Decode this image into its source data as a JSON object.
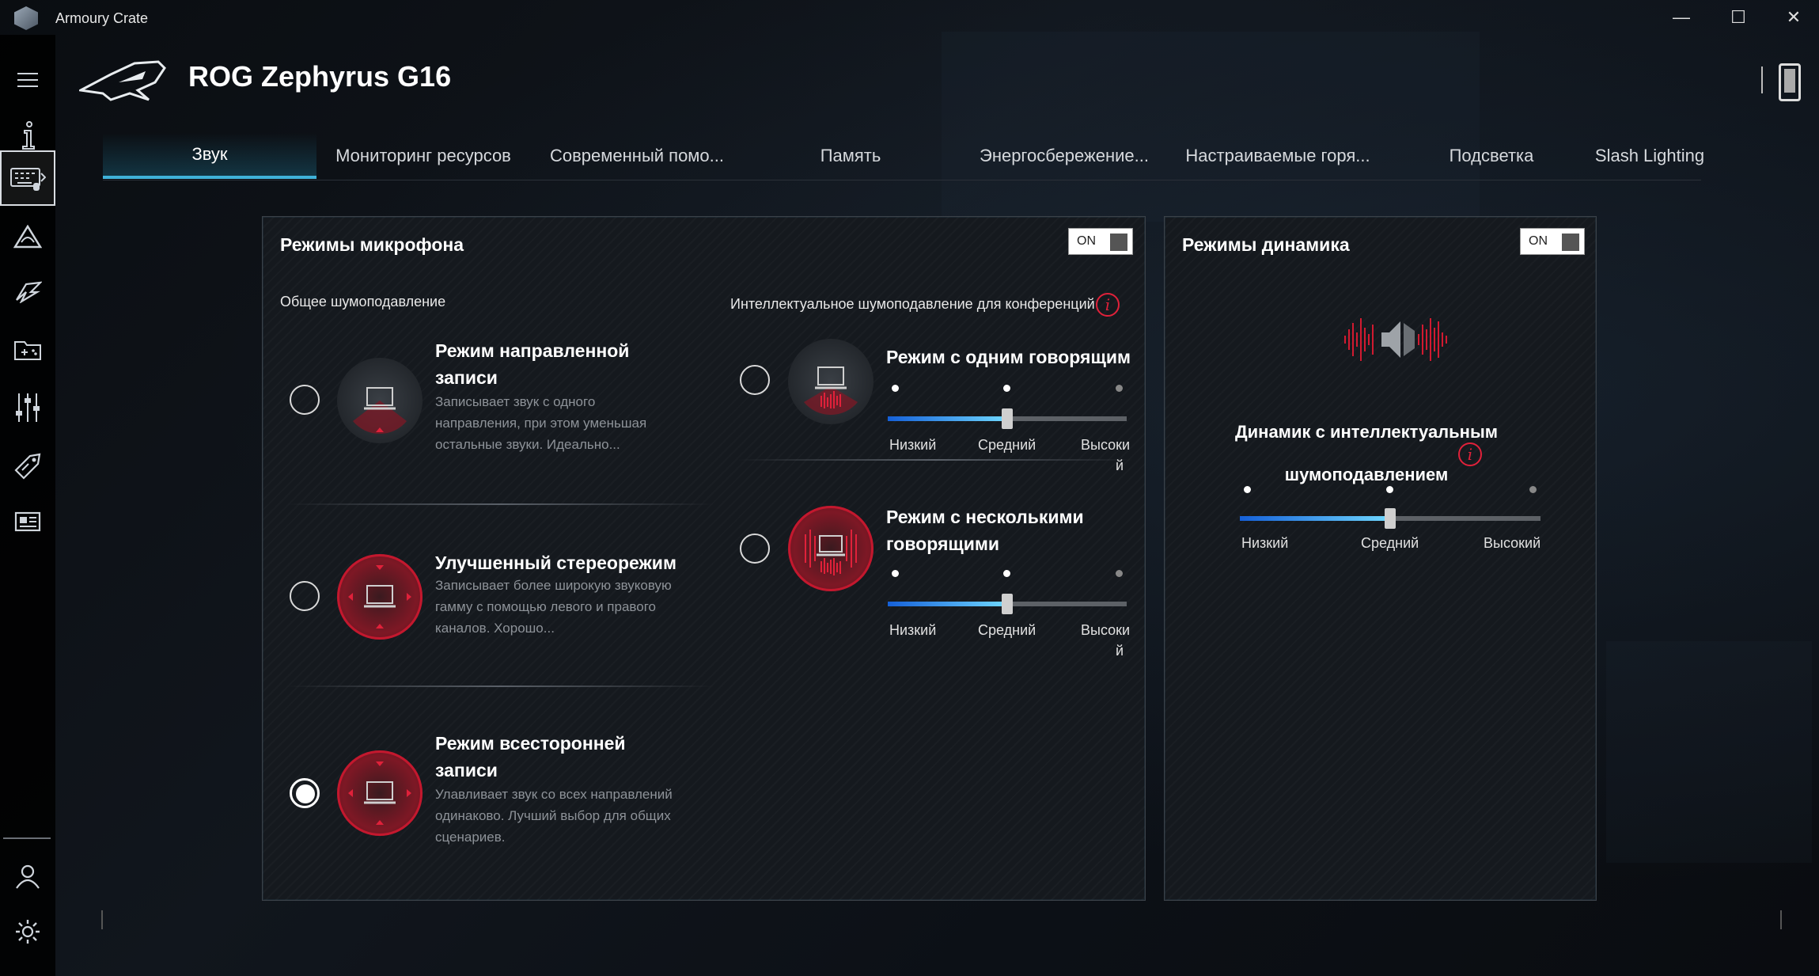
{
  "window": {
    "app_title": "Armoury Crate",
    "minimize_glyph": "—",
    "maximize_glyph": "☐",
    "close_glyph": "✕"
  },
  "header": {
    "device_name": "ROG Zephyrus G16"
  },
  "sidebar": {
    "items": [
      {
        "icon": "hamburger-menu-icon"
      },
      {
        "icon": "info-icon"
      },
      {
        "icon": "keyboard-device-icon",
        "active": true
      },
      {
        "icon": "aura-sync-icon"
      },
      {
        "icon": "armoury-scenario-icon"
      },
      {
        "icon": "game-library-icon"
      },
      {
        "icon": "settings-sliders-icon"
      },
      {
        "icon": "deals-tag-icon"
      },
      {
        "icon": "news-icon"
      },
      {
        "icon": "user-center-icon"
      },
      {
        "icon": "settings-gear-icon"
      }
    ]
  },
  "tabs": [
    {
      "label": "Звук",
      "active": true
    },
    {
      "label": "Мониторинг ресурсов"
    },
    {
      "label": "Современный помо..."
    },
    {
      "label": "Память"
    },
    {
      "label": "Энергосбережение..."
    },
    {
      "label": "Настраиваемые горя..."
    },
    {
      "label": "Подсветка"
    },
    {
      "label": "Slash Lighting"
    }
  ],
  "mic_panel": {
    "title": "Режимы микрофона",
    "toggle": "ON",
    "general_heading": "Общее шумоподавление",
    "ai_heading": "Интеллектуальное шумоподавление для конференций",
    "info_glyph": "i",
    "general_modes": [
      {
        "title": "Режим направленной записи",
        "desc": "Записывает звук с одного направления, при этом уменьшая остальные звуки. Идеально...",
        "selected": false
      },
      {
        "title": "Улучшенный стереорежим",
        "desc": "Записывает более широкую звуковую гамму с помощью левого и правого каналов. Хорошо...",
        "selected": false
      },
      {
        "title": "Режим всесторонней записи",
        "desc": "Улавливает звук со всех направлений одинаково. Лучший выбор для общих сценариев.",
        "selected": true
      }
    ],
    "ai_modes": [
      {
        "title": "Режим с одним говорящим",
        "selected": false,
        "level": 0.5,
        "labels": {
          "low": "Низкий",
          "mid": "Средний",
          "high": "Высоки",
          "high_wrap": "й"
        }
      },
      {
        "title": "Режим с несколькими говорящими",
        "selected": false,
        "level": 0.5,
        "labels": {
          "low": "Низкий",
          "mid": "Средний",
          "high": "Высоки",
          "high_wrap": "й"
        }
      }
    ]
  },
  "speaker_panel": {
    "title": "Режимы динамика",
    "toggle": "ON",
    "mode_title_line1": "Динамик с интеллектуальным",
    "mode_title_line2": "шумоподавлением",
    "info_glyph": "i",
    "level": 0.5,
    "labels": {
      "low": "Низкий",
      "mid": "Средний",
      "high": "Высокий"
    }
  },
  "colors": {
    "accent_red": "#e0213a",
    "accent_cyan": "#3fb2d9"
  }
}
